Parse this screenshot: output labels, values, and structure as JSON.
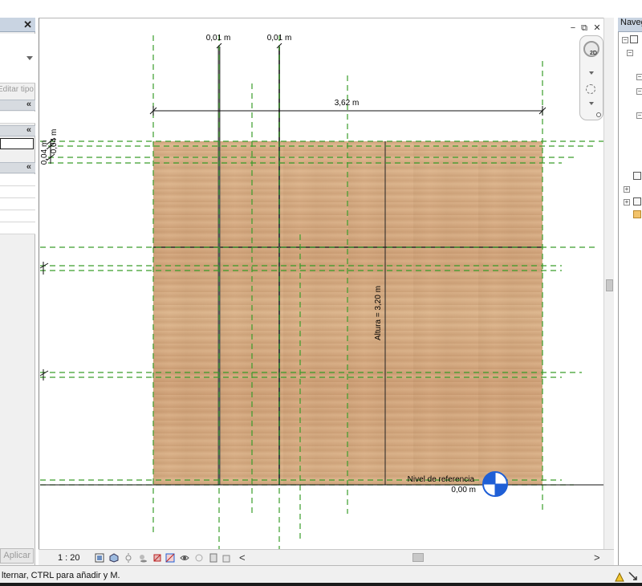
{
  "properties_panel": {
    "close_glyph": "✕",
    "edit_type_label": "Editar tipo",
    "apply_label": "Aplicar",
    "collapse_glyph": "«"
  },
  "browser_panel": {
    "title": "Navegador de proyectos"
  },
  "view": {
    "dimensions": {
      "top_left": "0,01 m",
      "top_right": "0,01 m",
      "width": "3,62 m",
      "left_a": "0,04 m",
      "left_b": "0,04 m",
      "height": "Altura = 3,20 m"
    },
    "level": {
      "name": "Nivel de referencia",
      "elevation": "0,00 m"
    },
    "window_controls": {
      "minimize": "−",
      "restore": "⧉",
      "close": "✕"
    },
    "colors": {
      "reference_plane": "#3a9d2a",
      "wood": "#d8ad84",
      "level_marker": "#1f5fd6"
    }
  },
  "view_control_bar": {
    "scale": "1 : 20",
    "scroll_left": "<",
    "scroll_right": ">"
  },
  "status_bar": {
    "text": "lternar, CTRL para añadir y M."
  }
}
